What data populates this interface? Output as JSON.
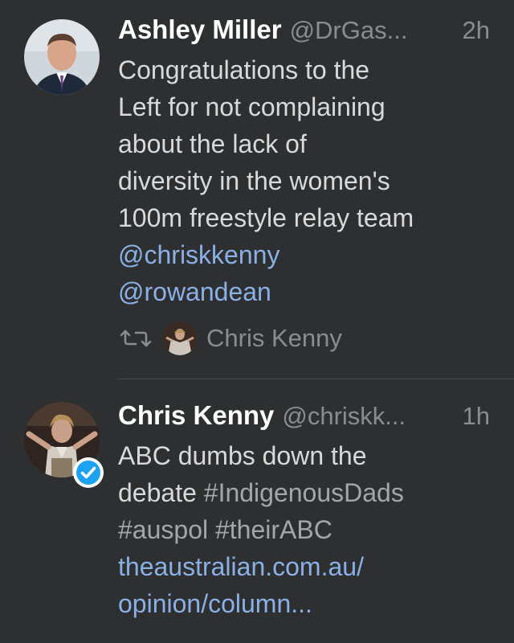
{
  "tweets": [
    {
      "author_name": "Ashley Miller",
      "author_handle": "@DrGas...",
      "time": "2h",
      "lines": [
        "Congratulations to the",
        "Left for not complaining",
        "about the lack of",
        "diversity in the women's",
        "100m freestyle relay team"
      ],
      "mentions": [
        "@chriskkenny",
        "@rowandean"
      ],
      "retweeted_by": "Chris Kenny"
    },
    {
      "author_name": "Chris Kenny",
      "author_handle": "@chriskk...",
      "time": "1h",
      "verified": true,
      "line1": "ABC dumbs down the",
      "line2_text": "debate ",
      "hashtags": [
        "#IndigenousDads",
        "#auspol",
        "#theirABC"
      ],
      "link_lines": [
        "theaustralian.com.au/",
        "opinion/column..."
      ]
    }
  ],
  "colors": {
    "background": "#2e2f30",
    "name": "#ffffff",
    "text": "#d9d9d9",
    "meta": "#8a8d90",
    "link": "#8ab0e6",
    "verified": "#1da1f2"
  },
  "icons": {
    "retweet": "retweet-icon",
    "verified": "verified-badge-icon"
  }
}
